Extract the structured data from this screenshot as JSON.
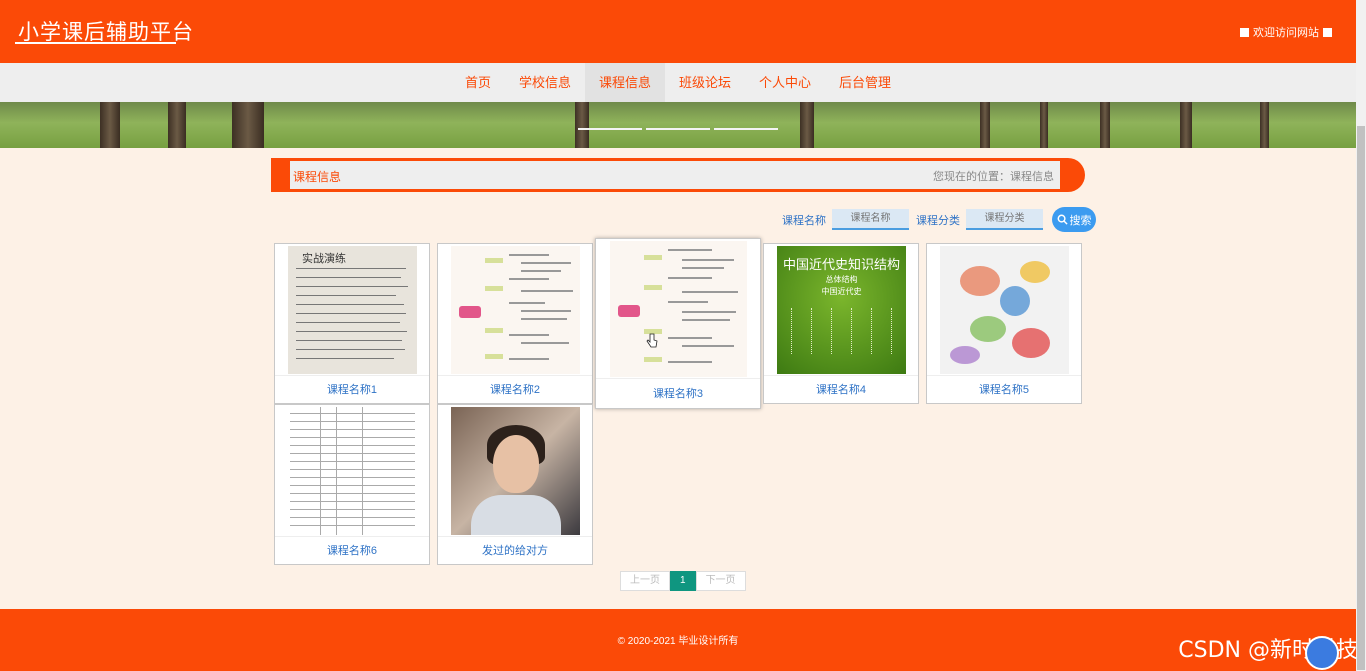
{
  "header": {
    "title": "小学课后辅助平台",
    "welcome": "欢迎访问网站"
  },
  "nav": {
    "items": [
      {
        "label": "首页"
      },
      {
        "label": "学校信息"
      },
      {
        "label": "课程信息"
      },
      {
        "label": "班级论坛"
      },
      {
        "label": "个人中心"
      },
      {
        "label": "后台管理"
      }
    ],
    "active": "课程信息"
  },
  "section": {
    "title": "课程信息",
    "breadcrumb": "您现在的位置：课程信息"
  },
  "search": {
    "name_label": "课程名称",
    "name_placeholder": "课程名称",
    "category_label": "课程分类",
    "category_placeholder": "课程分类",
    "button": "搜索"
  },
  "cards": [
    {
      "label": "课程名称1"
    },
    {
      "label": "课程名称2"
    },
    {
      "label": "课程名称3"
    },
    {
      "label": "课程名称4"
    },
    {
      "label": "课程名称5"
    },
    {
      "label": "课程名称6"
    },
    {
      "label": "发过的给对方"
    }
  ],
  "thumb_text": {
    "handwriting_title": "实战演练",
    "green_title": "中国近代史知识结构",
    "green_sub1": "总体结构",
    "green_sub2": "中国近代史"
  },
  "pager": {
    "prev": "上一页",
    "current": "1",
    "next": "下一页"
  },
  "footer": {
    "copyright": "© 2020-2021 毕业设计所有"
  },
  "watermark": "CSDN @新时科技",
  "colors": {
    "brand": "#fb4a07",
    "link": "#2f73c6",
    "pager_active": "#0f9680",
    "search_button": "#3b9bf0"
  }
}
